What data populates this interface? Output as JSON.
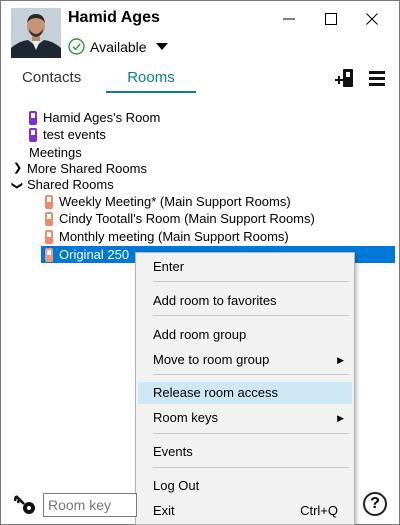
{
  "user": {
    "name": "Hamid Ages",
    "status": "Available"
  },
  "window": {
    "minimize_icon": "minimize-icon",
    "maximize_icon": "maximize-icon",
    "close_icon": "close-icon"
  },
  "tabs": [
    {
      "label": "Contacts",
      "active": false
    },
    {
      "label": "Rooms",
      "active": true
    }
  ],
  "toolbar": {
    "add_room_icon": "add-room-icon",
    "menu_icon": "hamburger-menu-icon"
  },
  "tree": {
    "rooms": [
      "Hamid Ages's Room",
      "test events"
    ],
    "meetings_label": "Meetings",
    "more_shared_label": "More Shared Rooms",
    "shared_label": "Shared Rooms",
    "shared_rooms": [
      "Weekly Meeting* (Main Support Rooms)",
      "Cindy Tootall's Room (Main Support Rooms)",
      "Monthly meeting (Main Support Rooms)",
      "Original 250"
    ]
  },
  "context_menu": {
    "enter": "Enter",
    "add_favorites": "Add room to favorites",
    "add_group": "Add room group",
    "move_group": "Move to room group",
    "release_access": "Release room access",
    "room_keys": "Room keys",
    "events": "Events",
    "log_out": "Log Out",
    "exit": "Exit",
    "exit_shortcut": "Ctrl+Q"
  },
  "footer": {
    "room_key_placeholder": "Room key",
    "help_label": "?"
  },
  "colors": {
    "accent": "#0f7d8f",
    "selection": "#0078d7",
    "menu_hover": "#cde8f4",
    "personal_room": "#7b2fd6",
    "shared_room": "#ef8a6b"
  }
}
